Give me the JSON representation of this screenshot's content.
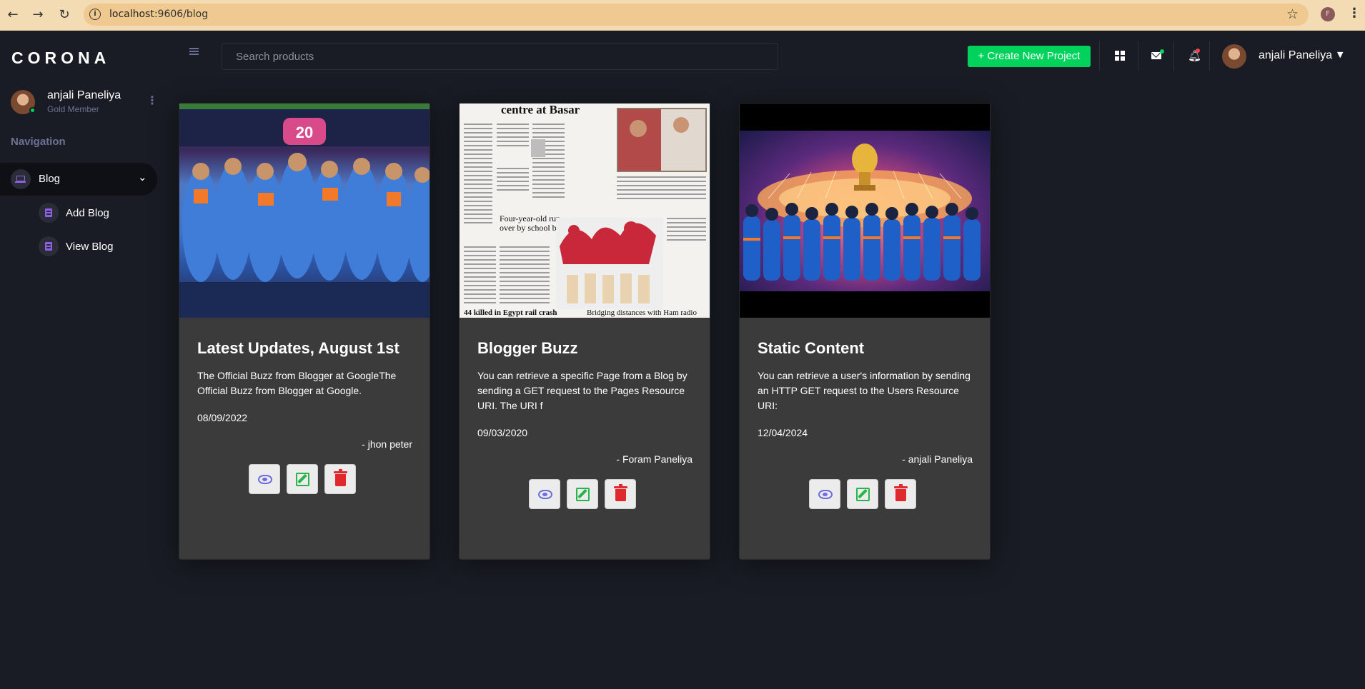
{
  "browser": {
    "url_host": "localhost",
    "url_path": ":9606/blog",
    "profile_initial": "F"
  },
  "sidebar": {
    "brand": "CORONA",
    "user": {
      "name": "anjali Paneliya",
      "role": "Gold Member"
    },
    "nav_heading": "Navigation",
    "items": [
      {
        "label": "Blog",
        "icon": "laptop-icon",
        "expanded": true,
        "children": [
          {
            "label": "Add Blog",
            "icon": "document-icon"
          },
          {
            "label": "View Blog",
            "icon": "document-icon"
          }
        ]
      }
    ]
  },
  "topbar": {
    "search_placeholder": "Search products",
    "create_button": "+ Create New Project",
    "username": "anjali Paneliya"
  },
  "cards": [
    {
      "image": "cricket-team-celebration-photo",
      "title": "Latest Updates, August 1st",
      "description": "The Official Buzz from Blogger at GoogleThe Official Buzz from Blogger at Google.",
      "date": "08/09/2022",
      "author": "- jhon peter"
    },
    {
      "image": "newspaper-page-photo",
      "title": "Blogger Buzz",
      "description": "You can retrieve a specific Page from a Blog by sending a GET request to the Pages Resource URI. The URI f",
      "date": "09/03/2020",
      "author": "- Foram Paneliya"
    },
    {
      "image": "cricket-team-stadium-trophy-photo",
      "title": "Static Content",
      "description": "You can retrieve a user's information by sending an HTTP GET request to the Users Resource URI:",
      "date": "12/04/2024",
      "author": "- anjali Paneliya"
    }
  ],
  "colors": {
    "background": "#191c24",
    "card": "#3b3b3b",
    "accent_green": "#00d25b",
    "nav_icon_purple": "#8f5fe8",
    "view_icon": "#6f6be0",
    "edit_icon": "#2ab34a",
    "delete_icon": "#e0282f"
  },
  "newspaper_text": {
    "headline": "centre at Basar",
    "sub1": "Four-year-old run",
    "sub1b": "over by school bus",
    "sub2": "44 killed in Egypt rail crash",
    "sub3": "Bridging distances with Ham radio"
  }
}
